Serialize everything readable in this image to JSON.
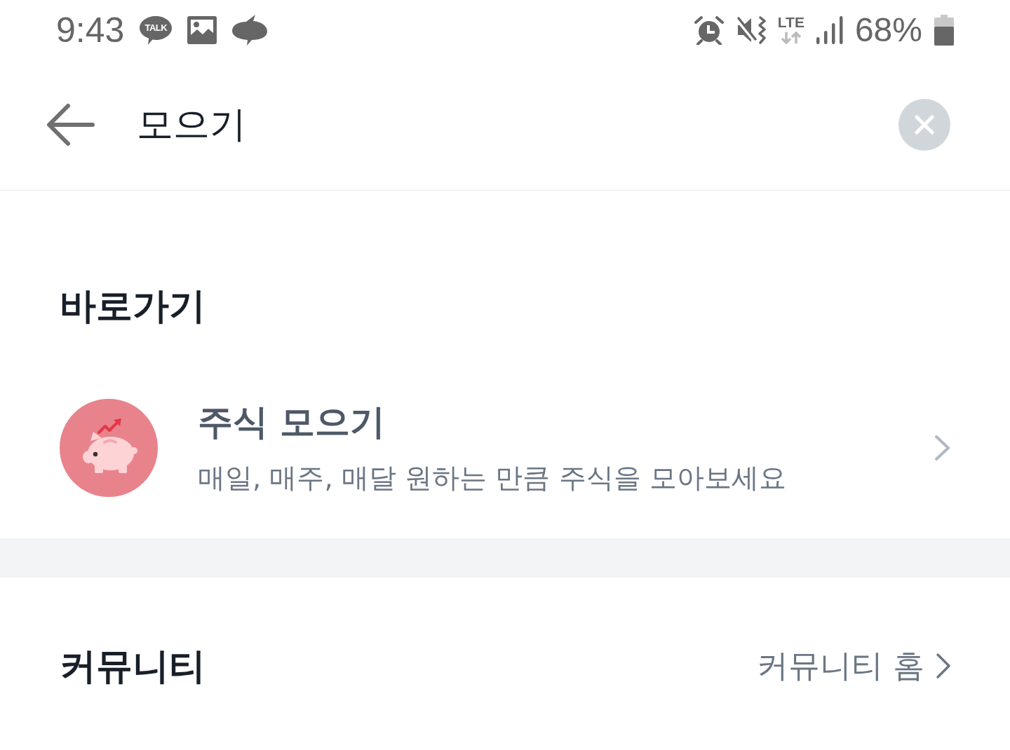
{
  "status_bar": {
    "time": "9:43",
    "talk_badge": "TALK",
    "network": "LTE",
    "battery": "68%"
  },
  "search": {
    "query": "모으기"
  },
  "shortcuts": {
    "title": "바로가기",
    "items": [
      {
        "title": "주식 모으기",
        "description": "매일, 매주, 매달 원하는 만큼 주식을 모아보세요"
      }
    ]
  },
  "community": {
    "title": "커뮤니티",
    "link": "커뮤니티 홈"
  }
}
